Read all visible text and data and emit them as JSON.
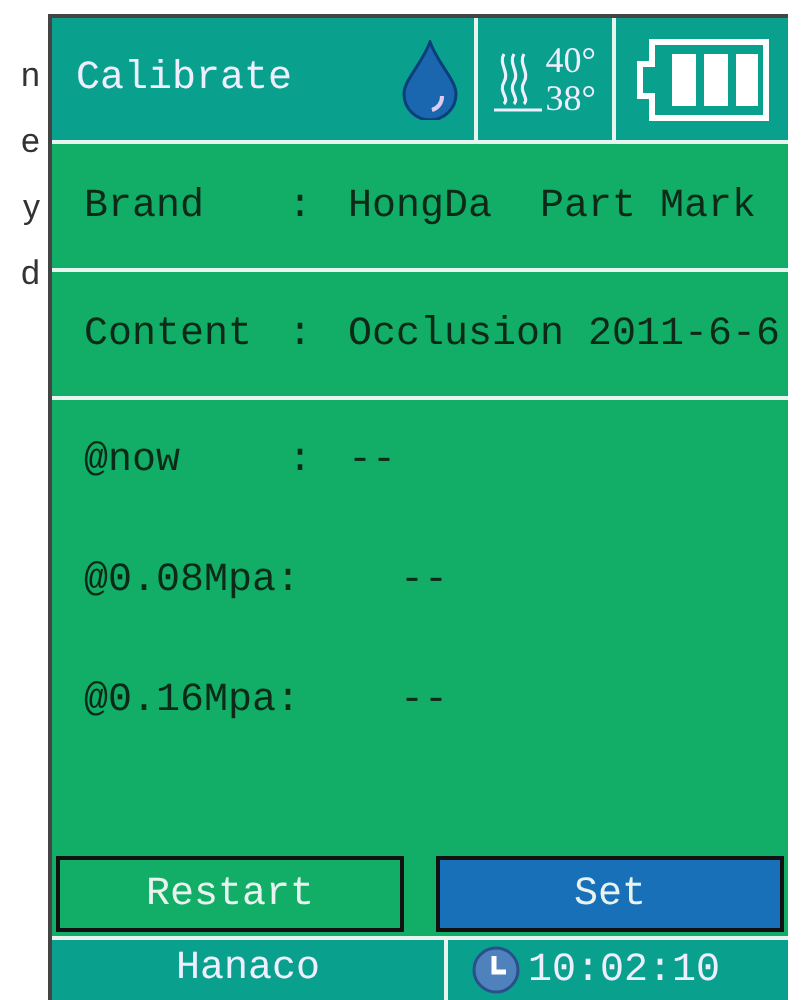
{
  "edge_text": [
    "n",
    "e",
    "y",
    "d"
  ],
  "header": {
    "title": "Calibrate",
    "temp_high": "40°",
    "temp_low": "38°"
  },
  "rows": [
    {
      "label": "Brand",
      "colon": ":",
      "value": "HongDa  Part Mark"
    },
    {
      "label": "Content",
      "colon": ":",
      "value": "Occlusion 2011-6-6"
    },
    {
      "label": "@now",
      "colon": ":",
      "value": "--"
    },
    {
      "label": "@0.08Mpa:",
      "value": "--"
    },
    {
      "label": "@0.16Mpa:",
      "value": "--"
    }
  ],
  "buttons": [
    {
      "label": "Restart",
      "selected": false
    },
    {
      "label": "Set",
      "selected": true
    }
  ],
  "footer": {
    "brand": "Hanaco",
    "time": "10:02:10"
  }
}
